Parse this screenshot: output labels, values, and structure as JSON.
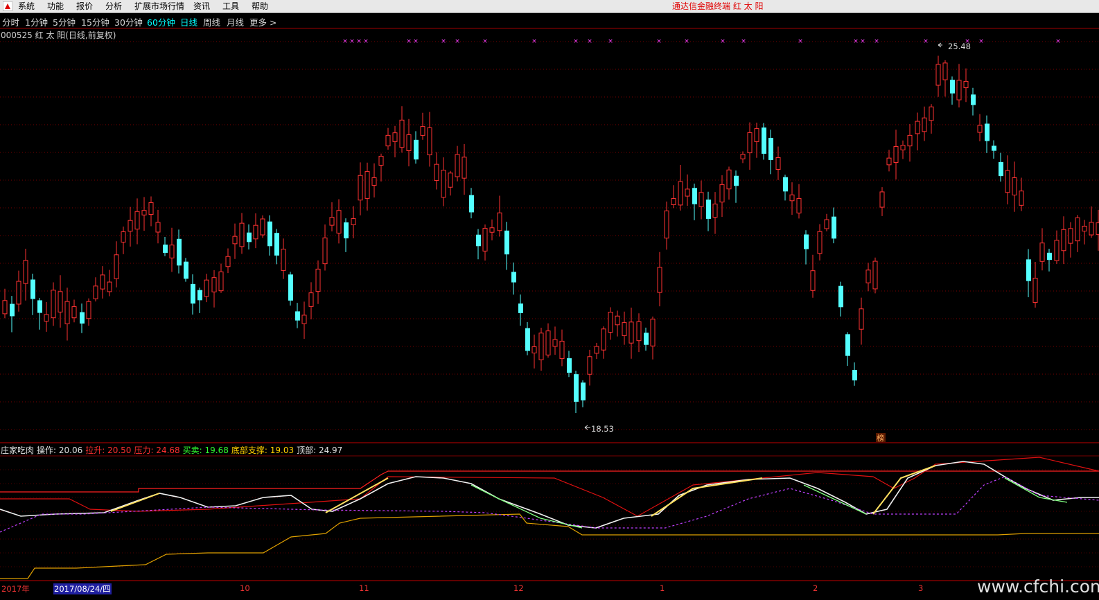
{
  "app": {
    "title": "通达信金融终端  红 太 阳",
    "menu": [
      "系统",
      "功能",
      "报价",
      "分析",
      "扩展市场行情",
      "资讯",
      "工具",
      "帮助"
    ]
  },
  "periods": {
    "items": [
      "分时",
      "1分钟",
      "5分钟",
      "15分钟",
      "30分钟",
      "60分钟",
      "日线",
      "周线",
      "月线",
      "更多 >"
    ],
    "active": "日线"
  },
  "stock": {
    "title": "000525 红 太 阳(日线,前复权)"
  },
  "price_chart": {
    "high_label": "25.48",
    "low_label": "18.53",
    "marker_label": "榜",
    "colors": {
      "up": "#ff3232",
      "down": "#54ffff",
      "x_marker": "#ff40ff",
      "grid": "#7a0000"
    }
  },
  "indicator": {
    "name": "庄家吃肉",
    "items": [
      {
        "label": "操作: ",
        "value": "20.06",
        "color": "#e0e0e0"
      },
      {
        "label": "拉升: ",
        "value": "20.50",
        "color": "#ff3030"
      },
      {
        "label": "压力: ",
        "value": "24.68",
        "color": "#ff3030"
      },
      {
        "label": "买卖: ",
        "value": "19.68",
        "color": "#30ff30"
      },
      {
        "label": "底部支撑: ",
        "value": "19.03",
        "color": "#ffd000"
      },
      {
        "label": "顶部: ",
        "value": "24.97",
        "color": "#e0e0e0"
      }
    ]
  },
  "date_axis": {
    "year": "2017年",
    "selected": "2017/08/24/四",
    "months": [
      "10",
      "11",
      "12",
      "1",
      "2",
      "3"
    ]
  },
  "watermark": "www.cfchi.com"
}
